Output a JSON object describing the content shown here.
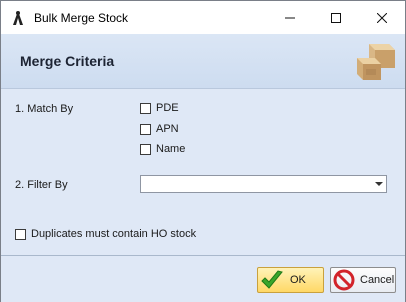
{
  "window": {
    "title": "Bulk Merge Stock"
  },
  "header": {
    "title": "Merge Criteria"
  },
  "criteria": {
    "match_by_label": "1. Match By",
    "options": [
      {
        "label": "PDE",
        "checked": false
      },
      {
        "label": "APN",
        "checked": false
      },
      {
        "label": "Name",
        "checked": false
      }
    ],
    "filter_by_label": "2. Filter By",
    "filter_value": "",
    "duplicates_label": "Duplicates must contain HO stock",
    "duplicates_checked": false
  },
  "buttons": {
    "ok": "OK",
    "cancel": "Cancel"
  },
  "icons": [
    "app-icon",
    "minimize-icon",
    "maximize-icon",
    "close-icon",
    "stock-boxes-icon",
    "checkmark-icon",
    "cancel-icon",
    "chevron-down-icon"
  ]
}
